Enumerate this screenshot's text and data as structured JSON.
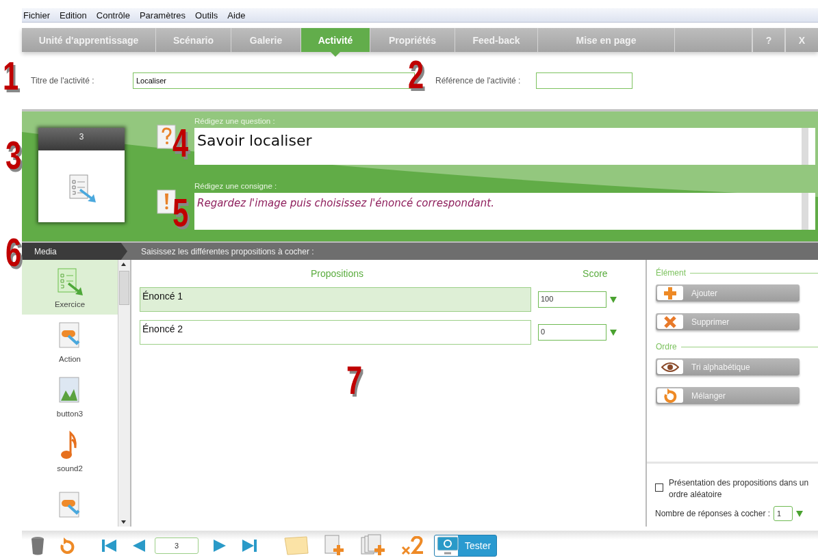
{
  "menu": [
    "Fichier",
    "Edition",
    "Contrôle",
    "Paramètres",
    "Outils",
    "Aide"
  ],
  "tabs": [
    {
      "label": "Unité d'apprentissage",
      "selected": false
    },
    {
      "label": "Scénario",
      "selected": false
    },
    {
      "label": "Galerie",
      "selected": false
    },
    {
      "label": "Activité",
      "selected": true
    },
    {
      "label": "Propriétés",
      "selected": false
    },
    {
      "label": "Feed-back",
      "selected": false
    },
    {
      "label": "Mise en page",
      "selected": false
    }
  ],
  "window_buttons": [
    "?",
    "X"
  ],
  "title_field": {
    "label": "Titre de l'activité :",
    "value": "Localiser"
  },
  "reference_field": {
    "label": "Référence de l'activité :"
  },
  "thumbnail": {
    "number": "3"
  },
  "question": {
    "label": "Rédigez une question :",
    "value": "Savoir localiser"
  },
  "instruction": {
    "label": "Rédigez une consigne :",
    "value": "Regardez l'image puis choisissez l'énoncé correspondant."
  },
  "media_bar": {
    "title": "Media",
    "heading": "Saisissez les différentes propositions à cocher :"
  },
  "media": [
    {
      "kind": "exercise",
      "label": "Exercice",
      "selected": true
    },
    {
      "kind": "action",
      "label": "Action",
      "selected": false
    },
    {
      "kind": "image",
      "label": "button3",
      "selected": false
    },
    {
      "kind": "sound",
      "label": "sound2",
      "selected": false
    },
    {
      "kind": "action",
      "selected": false
    }
  ],
  "propositions": {
    "col_text": "Propositions",
    "col_score": "Score",
    "rows": [
      {
        "text": "Énoncé 1",
        "score": "100",
        "selected": true
      },
      {
        "text": "Énoncé 2",
        "score": "0",
        "selected": false
      }
    ]
  },
  "side_groups": [
    {
      "title": "Élément",
      "buttons": [
        {
          "kind": "add",
          "label": "Ajouter"
        },
        {
          "kind": "delete",
          "label": "Supprimer"
        }
      ]
    },
    {
      "title": "Ordre",
      "buttons": [
        {
          "kind": "sort",
          "label": "Tri alphabétique"
        },
        {
          "kind": "shuffle",
          "label": "Mélanger"
        }
      ]
    }
  ],
  "random_option": {
    "label": "Présentation des propositions dans un ordre aléatoire",
    "checked": false
  },
  "answer_count": {
    "label": "Nombre de réponses à cocher :",
    "value": "1"
  },
  "page_field": {
    "value": "3"
  },
  "test_button": {
    "label": "Tester"
  },
  "callouts": [
    "1",
    "2",
    "3",
    "4",
    "5",
    "6",
    "7"
  ]
}
